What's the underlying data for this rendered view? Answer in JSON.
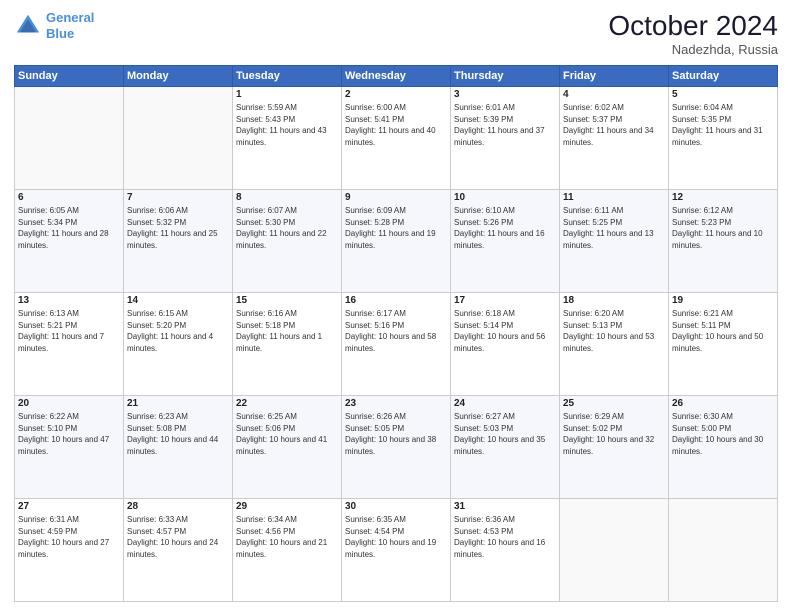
{
  "header": {
    "logo_line1": "General",
    "logo_line2": "Blue",
    "month": "October 2024",
    "location": "Nadezhda, Russia"
  },
  "days_of_week": [
    "Sunday",
    "Monday",
    "Tuesday",
    "Wednesday",
    "Thursday",
    "Friday",
    "Saturday"
  ],
  "weeks": [
    [
      {
        "day": "",
        "info": ""
      },
      {
        "day": "",
        "info": ""
      },
      {
        "day": "1",
        "info": "Sunrise: 5:59 AM\nSunset: 5:43 PM\nDaylight: 11 hours and 43 minutes."
      },
      {
        "day": "2",
        "info": "Sunrise: 6:00 AM\nSunset: 5:41 PM\nDaylight: 11 hours and 40 minutes."
      },
      {
        "day": "3",
        "info": "Sunrise: 6:01 AM\nSunset: 5:39 PM\nDaylight: 11 hours and 37 minutes."
      },
      {
        "day": "4",
        "info": "Sunrise: 6:02 AM\nSunset: 5:37 PM\nDaylight: 11 hours and 34 minutes."
      },
      {
        "day": "5",
        "info": "Sunrise: 6:04 AM\nSunset: 5:35 PM\nDaylight: 11 hours and 31 minutes."
      }
    ],
    [
      {
        "day": "6",
        "info": "Sunrise: 6:05 AM\nSunset: 5:34 PM\nDaylight: 11 hours and 28 minutes."
      },
      {
        "day": "7",
        "info": "Sunrise: 6:06 AM\nSunset: 5:32 PM\nDaylight: 11 hours and 25 minutes."
      },
      {
        "day": "8",
        "info": "Sunrise: 6:07 AM\nSunset: 5:30 PM\nDaylight: 11 hours and 22 minutes."
      },
      {
        "day": "9",
        "info": "Sunrise: 6:09 AM\nSunset: 5:28 PM\nDaylight: 11 hours and 19 minutes."
      },
      {
        "day": "10",
        "info": "Sunrise: 6:10 AM\nSunset: 5:26 PM\nDaylight: 11 hours and 16 minutes."
      },
      {
        "day": "11",
        "info": "Sunrise: 6:11 AM\nSunset: 5:25 PM\nDaylight: 11 hours and 13 minutes."
      },
      {
        "day": "12",
        "info": "Sunrise: 6:12 AM\nSunset: 5:23 PM\nDaylight: 11 hours and 10 minutes."
      }
    ],
    [
      {
        "day": "13",
        "info": "Sunrise: 6:13 AM\nSunset: 5:21 PM\nDaylight: 11 hours and 7 minutes."
      },
      {
        "day": "14",
        "info": "Sunrise: 6:15 AM\nSunset: 5:20 PM\nDaylight: 11 hours and 4 minutes."
      },
      {
        "day": "15",
        "info": "Sunrise: 6:16 AM\nSunset: 5:18 PM\nDaylight: 11 hours and 1 minute."
      },
      {
        "day": "16",
        "info": "Sunrise: 6:17 AM\nSunset: 5:16 PM\nDaylight: 10 hours and 58 minutes."
      },
      {
        "day": "17",
        "info": "Sunrise: 6:18 AM\nSunset: 5:14 PM\nDaylight: 10 hours and 56 minutes."
      },
      {
        "day": "18",
        "info": "Sunrise: 6:20 AM\nSunset: 5:13 PM\nDaylight: 10 hours and 53 minutes."
      },
      {
        "day": "19",
        "info": "Sunrise: 6:21 AM\nSunset: 5:11 PM\nDaylight: 10 hours and 50 minutes."
      }
    ],
    [
      {
        "day": "20",
        "info": "Sunrise: 6:22 AM\nSunset: 5:10 PM\nDaylight: 10 hours and 47 minutes."
      },
      {
        "day": "21",
        "info": "Sunrise: 6:23 AM\nSunset: 5:08 PM\nDaylight: 10 hours and 44 minutes."
      },
      {
        "day": "22",
        "info": "Sunrise: 6:25 AM\nSunset: 5:06 PM\nDaylight: 10 hours and 41 minutes."
      },
      {
        "day": "23",
        "info": "Sunrise: 6:26 AM\nSunset: 5:05 PM\nDaylight: 10 hours and 38 minutes."
      },
      {
        "day": "24",
        "info": "Sunrise: 6:27 AM\nSunset: 5:03 PM\nDaylight: 10 hours and 35 minutes."
      },
      {
        "day": "25",
        "info": "Sunrise: 6:29 AM\nSunset: 5:02 PM\nDaylight: 10 hours and 32 minutes."
      },
      {
        "day": "26",
        "info": "Sunrise: 6:30 AM\nSunset: 5:00 PM\nDaylight: 10 hours and 30 minutes."
      }
    ],
    [
      {
        "day": "27",
        "info": "Sunrise: 6:31 AM\nSunset: 4:59 PM\nDaylight: 10 hours and 27 minutes."
      },
      {
        "day": "28",
        "info": "Sunrise: 6:33 AM\nSunset: 4:57 PM\nDaylight: 10 hours and 24 minutes."
      },
      {
        "day": "29",
        "info": "Sunrise: 6:34 AM\nSunset: 4:56 PM\nDaylight: 10 hours and 21 minutes."
      },
      {
        "day": "30",
        "info": "Sunrise: 6:35 AM\nSunset: 4:54 PM\nDaylight: 10 hours and 19 minutes."
      },
      {
        "day": "31",
        "info": "Sunrise: 6:36 AM\nSunset: 4:53 PM\nDaylight: 10 hours and 16 minutes."
      },
      {
        "day": "",
        "info": ""
      },
      {
        "day": "",
        "info": ""
      }
    ]
  ]
}
